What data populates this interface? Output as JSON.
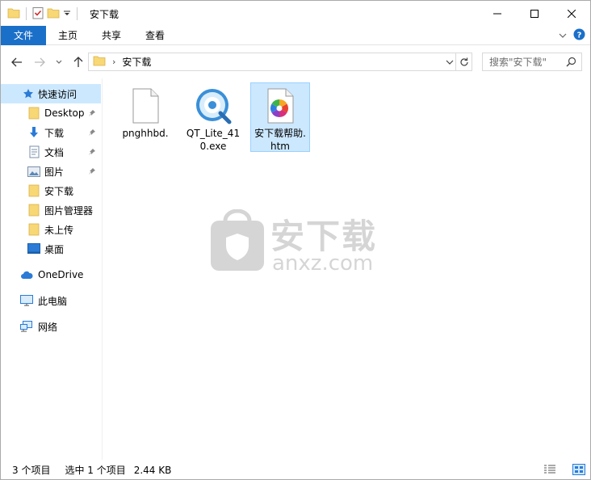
{
  "window": {
    "title": "安下载"
  },
  "ribbon": {
    "tabs": [
      "文件",
      "主页",
      "共享",
      "查看"
    ]
  },
  "address": {
    "path": "安下载"
  },
  "search": {
    "placeholder": "搜索\"安下载\""
  },
  "sidebar": {
    "items": [
      {
        "label": "快速访问",
        "icon": "star-icon"
      },
      {
        "label": "Desktop",
        "icon": "folder-icon",
        "pinned": true
      },
      {
        "label": "下载",
        "icon": "download-icon",
        "pinned": true
      },
      {
        "label": "文档",
        "icon": "document-icon",
        "pinned": true
      },
      {
        "label": "图片",
        "icon": "picture-icon",
        "pinned": true
      },
      {
        "label": "安下载",
        "icon": "folder-icon"
      },
      {
        "label": "图片管理器",
        "icon": "folder-icon"
      },
      {
        "label": "未上传",
        "icon": "folder-icon"
      },
      {
        "label": "桌面",
        "icon": "desktop-icon"
      },
      {
        "label": "OneDrive",
        "icon": "cloud-icon"
      },
      {
        "label": "此电脑",
        "icon": "computer-icon"
      },
      {
        "label": "网络",
        "icon": "network-icon"
      }
    ]
  },
  "files": [
    {
      "name": "pnghhbd.",
      "icon": "blank-file-icon"
    },
    {
      "name": "QT_Lite_410.exe",
      "icon": "quicktime-icon"
    },
    {
      "name": "安下载帮助.htm",
      "icon": "htm-file-icon",
      "selected": true
    }
  ],
  "status": {
    "count": "3 个项目",
    "selected": "选中 1 个项目",
    "size": "2.44 KB"
  },
  "watermark": {
    "text": "安下载",
    "url": "anxz.com"
  },
  "colors": {
    "accent": "#1a6fc9",
    "selection": "#cce8ff",
    "folder": "#f8d775"
  }
}
